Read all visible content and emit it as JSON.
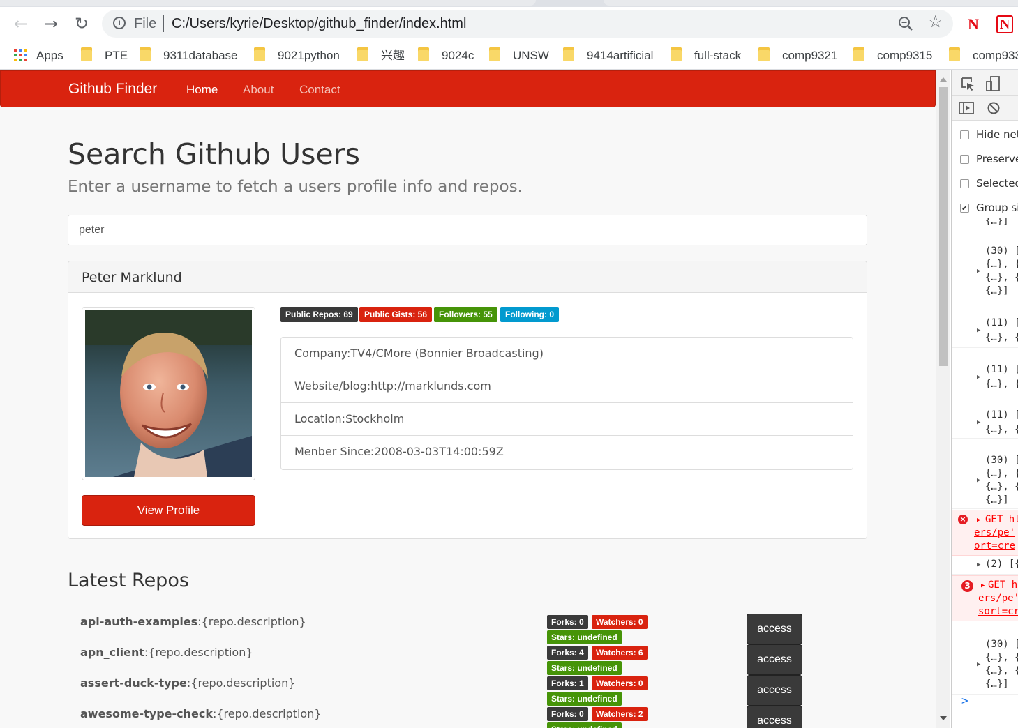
{
  "browser": {
    "url_scheme": "File",
    "url": "C:/Users/kyrie/Desktop/github_finder/index.html",
    "extensions": [
      "N",
      "N"
    ],
    "bookmarks": [
      "Apps",
      "PTE",
      "9311database",
      "9021python",
      "兴趣",
      "9024c",
      "UNSW",
      "9414artificial",
      "full-stack",
      "comp9321",
      "comp9315",
      "comp933"
    ]
  },
  "navbar": {
    "brand": "Github Finder",
    "links": [
      "Home",
      "About",
      "Contact"
    ]
  },
  "search": {
    "heading": "Search Github Users",
    "subheading": "Enter a username to fetch a users profile info and repos.",
    "value": "peter"
  },
  "profile": {
    "name": "Peter Marklund",
    "view_profile_label": "View Profile",
    "badges": [
      "Public Repos: 69",
      "Public Gists: 56",
      "Followers: 55",
      "Following: 0"
    ],
    "info": [
      "Company:TV4/CMore (Bonnier Broadcasting)",
      "Website/blog:http://marklunds.com",
      "Location:Stockholm",
      "Menber Since:2008-03-03T14:00:59Z"
    ]
  },
  "repos": {
    "heading": "Latest Repos",
    "items": [
      {
        "name": "api-auth-examples",
        "desc": ":{repo.description}",
        "forks": "Forks: 0",
        "watchers": "Watchers: 0",
        "stars": "Stars: undefined",
        "action": "access"
      },
      {
        "name": "apn_client",
        "desc": ":{repo.description}",
        "forks": "Forks: 4",
        "watchers": "Watchers: 6",
        "stars": "Stars: undefined",
        "action": "access"
      },
      {
        "name": "assert-duck-type",
        "desc": ":{repo.description}",
        "forks": "Forks: 1",
        "watchers": "Watchers: 0",
        "stars": "Stars: undefined",
        "action": "access"
      },
      {
        "name": "awesome-type-check",
        "desc": ":{repo.description}",
        "forks": "Forks: 0",
        "watchers": "Watchers: 2",
        "stars": "Stars: undefined",
        "action": "access"
      }
    ]
  },
  "devtools": {
    "options": [
      {
        "label": "Hide net",
        "checked": false
      },
      {
        "label": "Preserve",
        "checked": false
      },
      {
        "label": "Selected",
        "checked": false
      },
      {
        "label": "Group si",
        "checked": true
      }
    ],
    "logs": [
      {
        "lines": [
          "{…}]"
        ]
      },
      {
        "lines": [
          "(30) [",
          "{…}, {",
          "{…}, {",
          "{…}]"
        ]
      },
      {
        "lines": [
          "(11) [",
          "{…}, {"
        ]
      },
      {
        "lines": [
          "(11) [",
          "{…}, {"
        ]
      },
      {
        "lines": [
          "(11) [",
          "{…}, {"
        ]
      },
      {
        "lines": [
          "(30) [",
          "{…}, {",
          "{…}, {",
          "{…}]"
        ]
      },
      {
        "error": true,
        "lines": [
          "GET ht",
          "ers/pe'",
          "ort=cre"
        ]
      },
      {
        "lines": [
          "(2) [{"
        ]
      },
      {
        "error": true,
        "count": "3",
        "lines": [
          "GET h",
          "ers/pe'",
          "sort=cr"
        ]
      },
      {
        "lines": [
          "(30) [",
          "{…}, {",
          "{…}, {",
          "{…}]"
        ]
      }
    ],
    "prompt": ">"
  },
  "colors": {
    "navbar": "#d9230f",
    "badge_dark": "#3a3a3a",
    "badge_red": "#d9230f",
    "badge_green": "#469408",
    "badge_blue": "#029acf"
  }
}
